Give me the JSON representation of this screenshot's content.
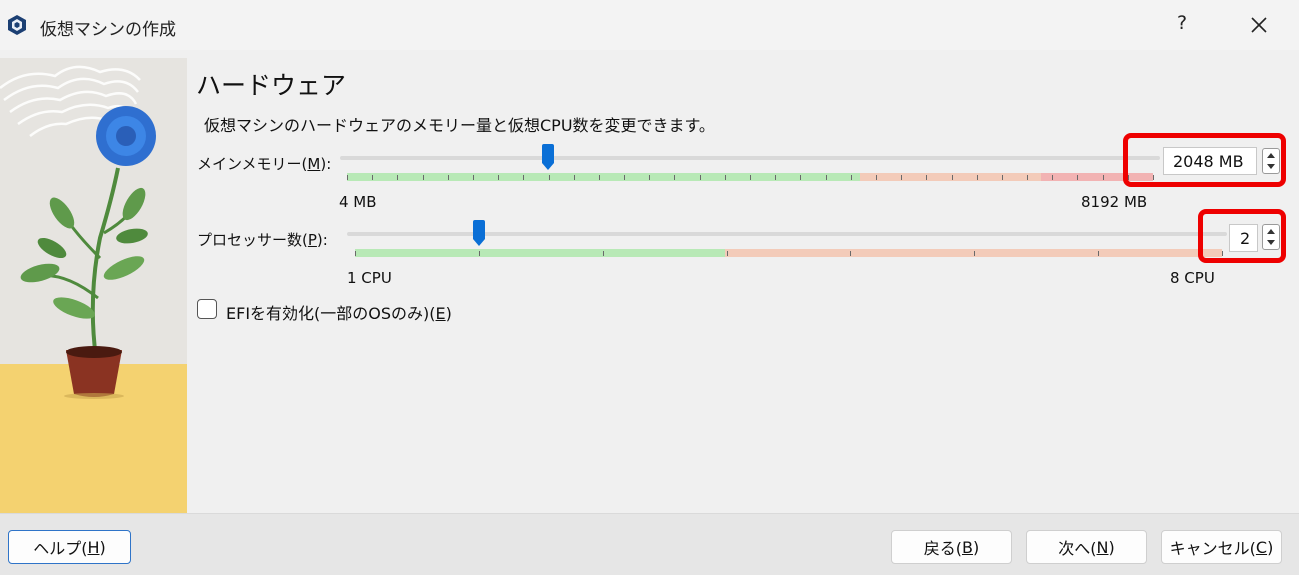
{
  "window": {
    "title": "仮想マシンの作成",
    "help_glyph": "?"
  },
  "page": {
    "heading": "ハードウェア",
    "description": "仮想マシンのハードウェアのメモリー量と仮想CPU数を変更できます。"
  },
  "memory": {
    "label_prefix": "メインメモリー(",
    "mnemonic": "M",
    "label_suffix": "):",
    "value": 2048,
    "value_text": "2048 MB",
    "min": 4,
    "max": 8192,
    "min_label": "4 MB",
    "max_label": "8192 MB",
    "range_colors": {
      "recommended": "#b8e9b6",
      "warning": "#f3cbb9",
      "danger": "#f2b3b3"
    }
  },
  "processors": {
    "label_prefix": "プロセッサー数(",
    "mnemonic": "P",
    "label_suffix": "):",
    "value": 2,
    "value_text": "2",
    "min": 1,
    "max": 8,
    "min_label": "1 CPU",
    "max_label": "8 CPU",
    "range_colors": {
      "recommended": "#b8e9b6",
      "warning": "#f3cbb9"
    }
  },
  "efi": {
    "checked": false,
    "label_prefix": "EFIを有効化(一部のOSのみ)(",
    "mnemonic": "E",
    "label_suffix": ")"
  },
  "buttons": {
    "help": {
      "prefix": "ヘルプ(",
      "mnemonic": "H",
      "suffix": ")"
    },
    "back": {
      "prefix": "戻る(",
      "mnemonic": "B",
      "suffix": ")"
    },
    "next": {
      "prefix": "次へ(",
      "mnemonic": "N",
      "suffix": ")"
    },
    "cancel": {
      "prefix": "キャンセル(",
      "mnemonic": "C",
      "suffix": ")"
    }
  },
  "colors": {
    "accent": "#0a6fd6",
    "highlight": "#ee0000",
    "footer_bg": "#e6e6e6"
  }
}
